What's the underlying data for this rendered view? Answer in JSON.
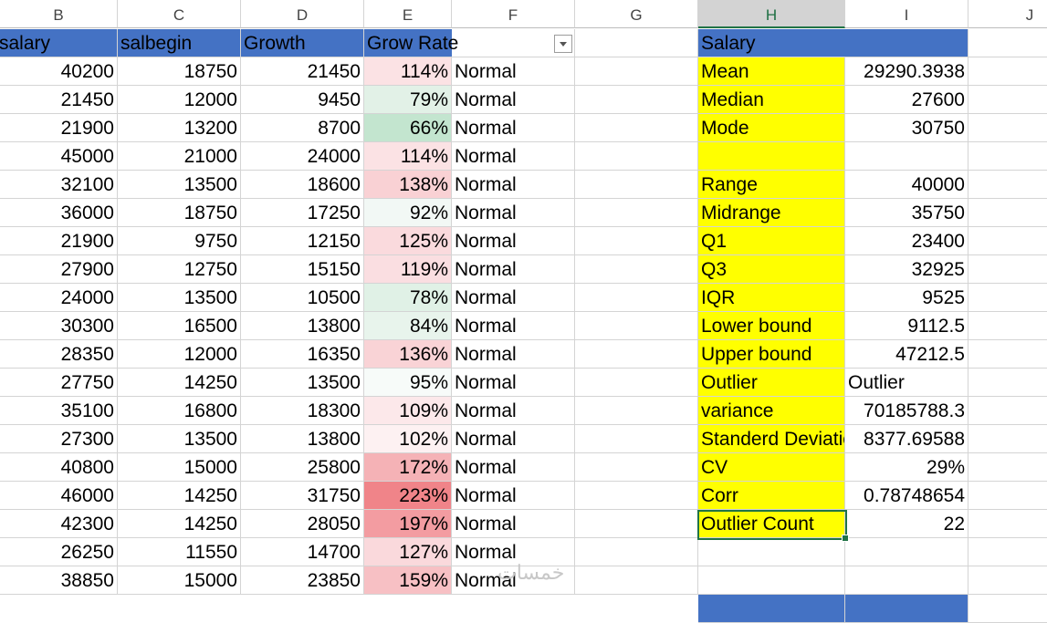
{
  "columns": [
    "B",
    "C",
    "D",
    "E",
    "F",
    "G",
    "H",
    "I",
    "J"
  ],
  "headers": {
    "b": "salary",
    "c": "salbegin",
    "d": "Growth",
    "e": "Grow Rate"
  },
  "rows": [
    {
      "b": "40200",
      "c": "18750",
      "d": "21450",
      "e": "114%",
      "f": "Normal",
      "color": "#fbe2e4"
    },
    {
      "b": "21450",
      "c": "12000",
      "d": "9450",
      "e": "79%",
      "f": "Normal",
      "color": "#e2f1e7"
    },
    {
      "b": "21900",
      "c": "13200",
      "d": "8700",
      "e": "66%",
      "f": "Normal",
      "color": "#c3e5cf"
    },
    {
      "b": "45000",
      "c": "21000",
      "d": "24000",
      "e": "114%",
      "f": "Normal",
      "color": "#fbe2e4"
    },
    {
      "b": "32100",
      "c": "13500",
      "d": "18600",
      "e": "138%",
      "f": "Normal",
      "color": "#f9d1d4"
    },
    {
      "b": "36000",
      "c": "18750",
      "d": "17250",
      "e": "92%",
      "f": "Normal",
      "color": "#f2f8f5"
    },
    {
      "b": "21900",
      "c": "9750",
      "d": "12150",
      "e": "125%",
      "f": "Normal",
      "color": "#fadadd"
    },
    {
      "b": "27900",
      "c": "12750",
      "d": "15150",
      "e": "119%",
      "f": "Normal",
      "color": "#fadee1"
    },
    {
      "b": "24000",
      "c": "13500",
      "d": "10500",
      "e": "78%",
      "f": "Normal",
      "color": "#e0f1e6"
    },
    {
      "b": "30300",
      "c": "16500",
      "d": "13800",
      "e": "84%",
      "f": "Normal",
      "color": "#e8f4ec"
    },
    {
      "b": "28350",
      "c": "12000",
      "d": "16350",
      "e": "136%",
      "f": "Normal",
      "color": "#f9d3d6"
    },
    {
      "b": "27750",
      "c": "14250",
      "d": "13500",
      "e": "95%",
      "f": "Normal",
      "color": "#f7fbf9"
    },
    {
      "b": "35100",
      "c": "16800",
      "d": "18300",
      "e": "109%",
      "f": "Normal",
      "color": "#fce8ea"
    },
    {
      "b": "27300",
      "c": "13500",
      "d": "13800",
      "e": "102%",
      "f": "Normal",
      "color": "#fdf1f2"
    },
    {
      "b": "40800",
      "c": "15000",
      "d": "25800",
      "e": "172%",
      "f": "Normal",
      "color": "#f5b2b6"
    },
    {
      "b": "46000",
      "c": "14250",
      "d": "31750",
      "e": "223%",
      "f": "Normal",
      "color": "#f08489"
    },
    {
      "b": "42300",
      "c": "14250",
      "d": "28050",
      "e": "197%",
      "f": "Normal",
      "color": "#f39ca1"
    },
    {
      "b": "26250",
      "c": "11550",
      "d": "14700",
      "e": "127%",
      "f": "Normal",
      "color": "#fad9dc"
    },
    {
      "b": "38850",
      "c": "15000",
      "d": "23850",
      "e": "159%",
      "f": "Normal",
      "color": "#f7c0c4"
    }
  ],
  "stats": {
    "title": "Salary",
    "items": [
      {
        "label": "Mean",
        "value": "29290.3938"
      },
      {
        "label": "Median",
        "value": "27600"
      },
      {
        "label": "Mode",
        "value": "30750"
      },
      {
        "label": "",
        "value": ""
      },
      {
        "label": "Range",
        "value": "40000"
      },
      {
        "label": "Midrange",
        "value": "35750"
      },
      {
        "label": "Q1",
        "value": "23400"
      },
      {
        "label": "Q3",
        "value": "32925"
      },
      {
        "label": "IQR",
        "value": "9525"
      },
      {
        "label": "Lower bound",
        "value": "9112.5"
      },
      {
        "label": "Upper bound",
        "value": "47212.5"
      },
      {
        "label": "Outlier",
        "value": "Outlier"
      },
      {
        "label": "variance",
        "value": "70185788.3"
      },
      {
        "label": "Standerd Deviation",
        "value": "8377.69588"
      },
      {
        "label": "CV",
        "value": "29%"
      },
      {
        "label": "Corr",
        "value": "0.78748654"
      },
      {
        "label": "Outlier Count",
        "value": "22"
      }
    ]
  },
  "watermark": "خمسات"
}
